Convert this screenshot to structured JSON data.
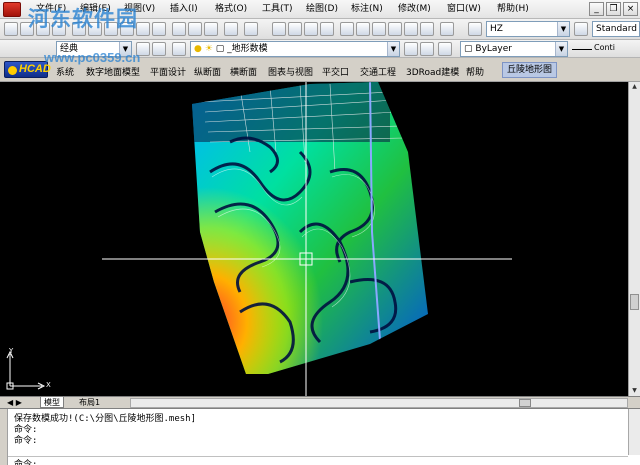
{
  "menubar": {
    "items": [
      "文件(F)",
      "编辑(E)",
      "视图(V)",
      "插入(I)",
      "格式(O)",
      "工具(T)",
      "绘图(D)",
      "标注(N)",
      "修改(M)",
      "窗口(W)",
      "帮助(H)"
    ]
  },
  "toolbar": {
    "textstyle_combo": "HZ",
    "dimstyle_combo": "Standard",
    "workspace_combo": "经典"
  },
  "layers": {
    "current_layer": "_地形数模",
    "color": "ByLayer",
    "linetype": "Conti"
  },
  "hcad_menu": {
    "logo": "HCAD",
    "items": [
      "系统",
      "数字地面模型",
      "平面设计",
      "纵断面",
      "横断面",
      "图表与视图",
      "平交口",
      "交通工程",
      "3DRoad建模",
      "帮助"
    ],
    "active_tab": "丘陵地形图"
  },
  "layout_tabs": [
    "模型",
    "布局1"
  ],
  "ucs": {
    "y_label": "Y",
    "x_label": "X"
  },
  "command": {
    "lines": [
      "保存数模成功!(C:\\分图\\丘陵地形图.mesh]",
      "命令:",
      "命令:"
    ],
    "prompt": "命令:"
  },
  "watermark": {
    "main": "河东软件园",
    "sub": "www.pc0359.cn"
  }
}
